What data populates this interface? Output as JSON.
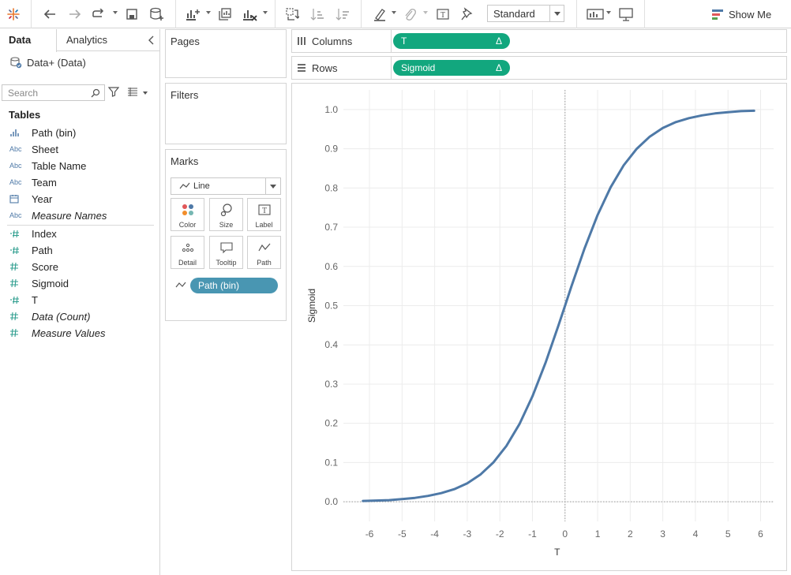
{
  "toolbar": {
    "fit": "Standard",
    "show_me": "Show Me",
    "colors": {
      "show_me_bars": [
        "#4e79a7",
        "#e15759",
        "#59a14f"
      ]
    }
  },
  "data_pane": {
    "tabs": {
      "active": "Data",
      "other": "Analytics"
    },
    "data_source": "Data+ (Data)",
    "search_placeholder": "Search",
    "tables_heading": "Tables",
    "dimensions": [
      {
        "icon": "bar-chart-icon",
        "label": "Path (bin)",
        "italic": false
      },
      {
        "icon": "abc-icon",
        "label": "Sheet",
        "italic": false
      },
      {
        "icon": "abc-icon",
        "label": "Table Name",
        "italic": false
      },
      {
        "icon": "abc-icon",
        "label": "Team",
        "italic": false
      },
      {
        "icon": "calendar-icon",
        "label": "Year",
        "italic": false
      },
      {
        "icon": "abc-icon",
        "label": "Measure Names",
        "italic": true
      }
    ],
    "measures": [
      {
        "icon": "numeric-dim-icon",
        "label": "Index",
        "italic": false
      },
      {
        "icon": "numeric-dim-icon",
        "label": "Path",
        "italic": false
      },
      {
        "icon": "hash-icon",
        "label": "Score",
        "italic": false
      },
      {
        "icon": "hash-icon",
        "label": "Sigmoid",
        "italic": false
      },
      {
        "icon": "numeric-dim-icon",
        "label": "T",
        "italic": false
      },
      {
        "icon": "hash-icon",
        "label": "Data (Count)",
        "italic": true
      },
      {
        "icon": "hash-icon",
        "label": "Measure Values",
        "italic": true
      }
    ]
  },
  "cards": {
    "pages": "Pages",
    "filters": "Filters",
    "marks": "Marks",
    "mark_type": "Line",
    "mark_buttons": [
      "Color",
      "Size",
      "Label",
      "Detail",
      "Tooltip",
      "Path"
    ],
    "path_pill": "Path (bin)"
  },
  "shelves": {
    "columns_label": "Columns",
    "columns_pill": "T",
    "rows_label": "Rows",
    "rows_pill": "Sigmoid",
    "pill_marker": "Δ",
    "pill_color": "#12a77e"
  },
  "chart_data": {
    "type": "line",
    "title": "",
    "xlabel": "T",
    "ylabel": "Sigmoid",
    "xlim": [
      -6.8,
      6.4
    ],
    "ylim": [
      -0.05,
      1.05
    ],
    "x_ticks": [
      -6,
      -5,
      -4,
      -3,
      -2,
      -1,
      0,
      1,
      2,
      3,
      4,
      5,
      6
    ],
    "y_ticks": [
      0.0,
      0.1,
      0.2,
      0.3,
      0.4,
      0.5,
      0.6,
      0.7,
      0.8,
      0.9,
      1.0
    ],
    "y_tick_labels": [
      "0.0",
      "0.1",
      "0.2",
      "0.3",
      "0.4",
      "0.5",
      "0.6",
      "0.7",
      "0.8",
      "0.9",
      "1.0"
    ],
    "grid": true,
    "line_color": "#4e79a7",
    "series": [
      {
        "x": [
          -6.2,
          -5.8,
          -5.4,
          -5.0,
          -4.6,
          -4.2,
          -3.8,
          -3.4,
          -3.0,
          -2.6,
          -2.2,
          -1.8,
          -1.4,
          -1.0,
          -0.6,
          -0.2,
          0.0,
          0.2,
          0.6,
          1.0,
          1.4,
          1.8,
          2.2,
          2.6,
          3.0,
          3.4,
          3.8,
          4.2,
          4.6,
          5.0,
          5.4,
          5.8
        ],
        "y": [
          0.002,
          0.003,
          0.004,
          0.007,
          0.01,
          0.015,
          0.022,
          0.032,
          0.047,
          0.069,
          0.1,
          0.142,
          0.198,
          0.269,
          0.354,
          0.45,
          0.5,
          0.55,
          0.646,
          0.731,
          0.802,
          0.858,
          0.9,
          0.931,
          0.953,
          0.968,
          0.978,
          0.985,
          0.99,
          0.993,
          0.996,
          0.997
        ]
      }
    ]
  }
}
